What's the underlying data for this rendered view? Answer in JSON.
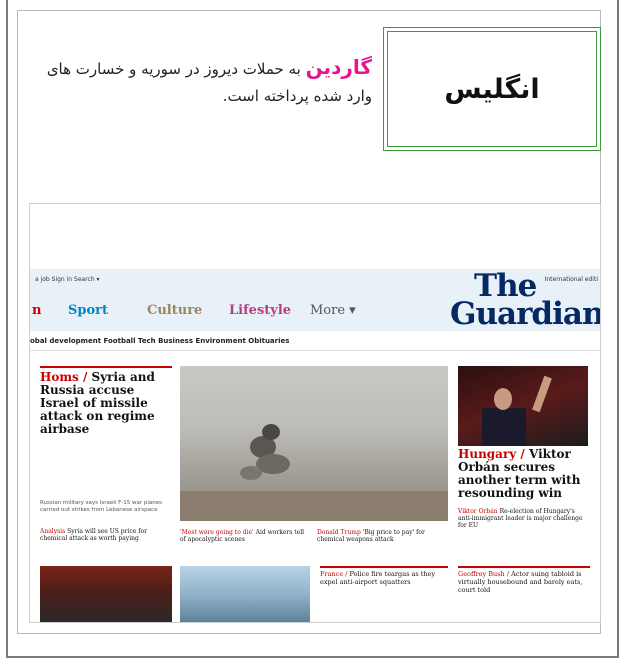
{
  "country": "انگلیس",
  "caption": {
    "paper_name": "گاردین",
    "text": " به حملات دیروز در سوریه و خسارت های وارد شده پرداخته است."
  },
  "screenshot": {
    "top_nav": "a job   Sign in   Search ▾",
    "international": "International editi",
    "logo_the": "The",
    "logo_guardian": "Guardian",
    "pillars": {
      "news_fragment": "n",
      "sport": "Sport",
      "culture": "Culture",
      "lifestyle": "Lifestyle",
      "more": "More ▾"
    },
    "subnav": "obal development  Football  Tech  Business  Environment  Obituaries",
    "lead": {
      "kicker": "Homs / ",
      "headline": "Syria and Russia accuse Israel of missile attack on regime airbase",
      "standfirst": "Russian military says Israeli F-15 war planes carried out strikes from Lebanese airspace",
      "analysis_kicker": "Analysis ",
      "analysis": "Syria will see US price for chemical attack as worth paying"
    },
    "middle_captions": [
      {
        "kicker": "'Most were going to die' ",
        "text": "Aid workers tell of apocalyptic scenes"
      },
      {
        "kicker": "Donald Trump ",
        "text": "'Big price to pay' for chemical weapons attack"
      }
    ],
    "right": {
      "kicker": "Hungary / ",
      "headline": "Viktor Orbán secures another term with resounding win",
      "sub_kicker": "Viktor Orbán ",
      "sub": "Re-election of Hungary's anti-immigrant leader is major challenge for EU"
    },
    "bottom": {
      "france_kicker": "France / ",
      "france": "Police fire teargas as they expel anti-airport squatters",
      "geoffrey_kicker": "Geoffrey Bush / ",
      "geoffrey": "Actor suing tabloid is virtually housebound and barely eats, court told"
    }
  }
}
